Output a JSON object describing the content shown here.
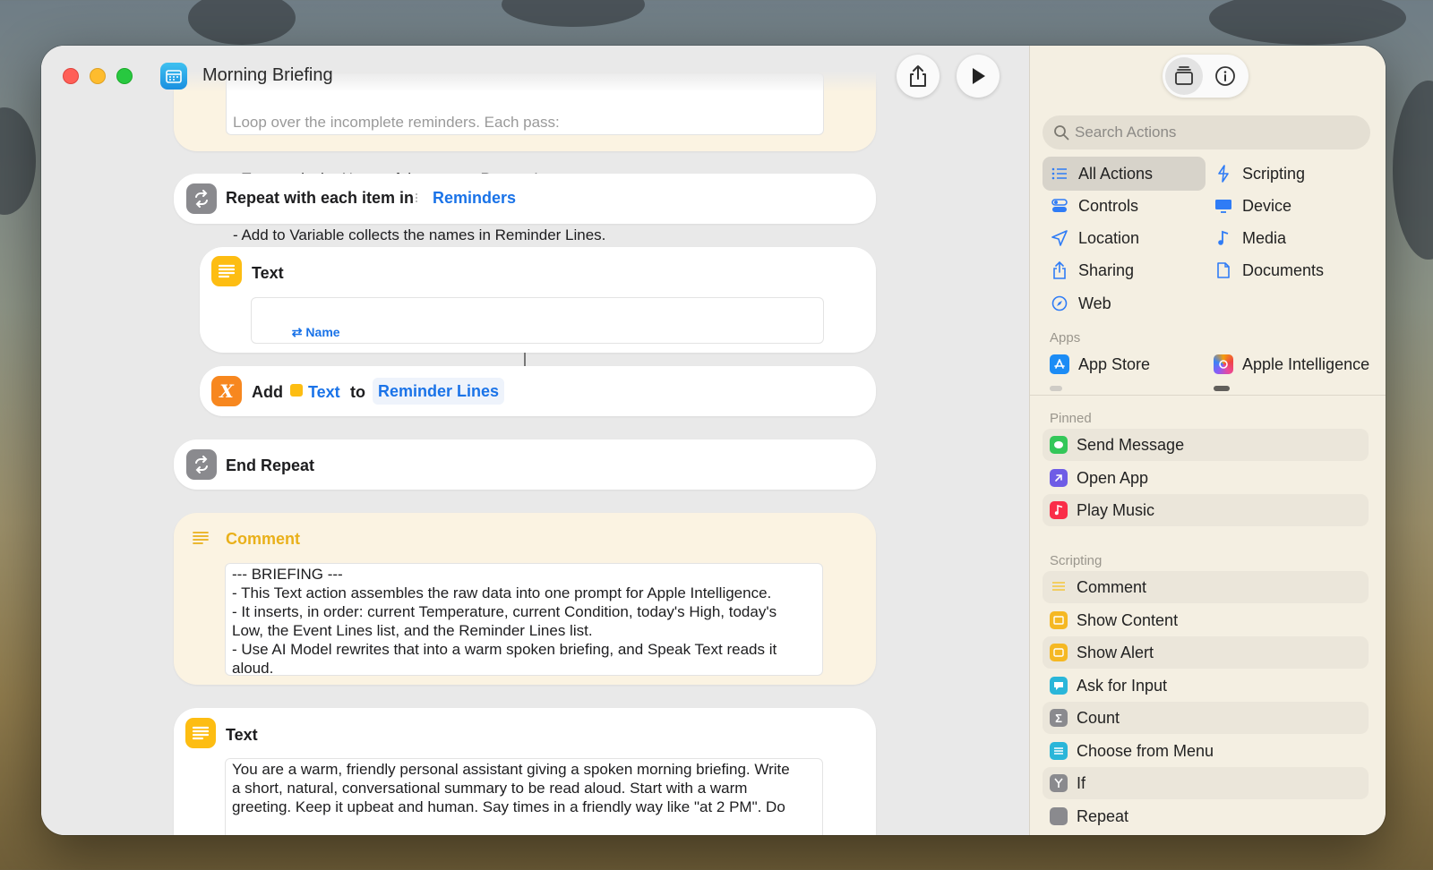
{
  "window": {
    "title": "Morning Briefing"
  },
  "editor": {
    "top_comment_lines": [
      "Loop over the incomplete reminders. Each pass:",
      "- Text reads the Name of the current Repeat Item.",
      "- Add to Variable collects the names in Reminder Lines."
    ],
    "repeat": {
      "label": "Repeat with each item in",
      "variable": "Reminders"
    },
    "text_action": {
      "title": "Text",
      "token": "Name"
    },
    "add_action": {
      "add": "Add",
      "token": "Text",
      "to": "to",
      "target": "Reminder Lines"
    },
    "end_repeat": {
      "label": "End Repeat"
    },
    "comment": {
      "title": "Comment",
      "body": "--- BRIEFING ---\n- This Text action assembles the raw data into one prompt for Apple Intelligence.\n- It inserts, in order: current Temperature, current Condition, today's High, today's\nLow, the Event Lines list, and the Reminder Lines list.\n- Use AI Model rewrites that into a warm spoken briefing, and Speak Text reads it\naloud."
    },
    "text_action_2": {
      "title": "Text",
      "body": "You are a warm, friendly personal assistant giving a spoken morning briefing. Write\na short, natural, conversational summary to be read aloud. Start with a warm\ngreeting. Keep it upbeat and human. Say times in a friendly way like \"at 2 PM\". Do"
    }
  },
  "sidebar": {
    "search_placeholder": "Search Actions",
    "categories": [
      {
        "label": "All Actions",
        "icon": "list-icon"
      },
      {
        "label": "Scripting",
        "icon": "scripting-icon"
      },
      {
        "label": "Controls",
        "icon": "controls-icon"
      },
      {
        "label": "Device",
        "icon": "device-icon"
      },
      {
        "label": "Location",
        "icon": "location-icon"
      },
      {
        "label": "Media",
        "icon": "music-note-icon"
      },
      {
        "label": "Sharing",
        "icon": "share-icon"
      },
      {
        "label": "Documents",
        "icon": "document-icon"
      },
      {
        "label": "Web",
        "icon": "compass-icon"
      }
    ],
    "apps_header": "Apps",
    "apps": [
      {
        "label": "App Store",
        "icon": "app-store-icon"
      },
      {
        "label": "Apple Intelligence",
        "icon": "apple-intelligence-icon"
      }
    ],
    "pinned_header": "Pinned",
    "pinned": [
      {
        "label": "Send Message",
        "color": "#34c759"
      },
      {
        "label": "Open App",
        "color": "#6e5ce6"
      },
      {
        "label": "Play Music",
        "color": "#fa2d48"
      }
    ],
    "scripting_header": "Scripting",
    "scripting": [
      {
        "label": "Comment",
        "color": "#f5c53a"
      },
      {
        "label": "Show Content",
        "color": "#f5b823"
      },
      {
        "label": "Show Alert",
        "color": "#f5b823"
      },
      {
        "label": "Ask for Input",
        "color": "#2ab6d9"
      },
      {
        "label": "Count",
        "color": "#8a8a8e"
      },
      {
        "label": "Choose from Menu",
        "color": "#2ab6d9"
      },
      {
        "label": "If",
        "color": "#8a8a8e"
      },
      {
        "label": "Repeat",
        "color": "#8a8a8e"
      }
    ]
  },
  "colors": {
    "accent_blue": "#1a73e8",
    "comment_yellow": "#e9b01a"
  }
}
